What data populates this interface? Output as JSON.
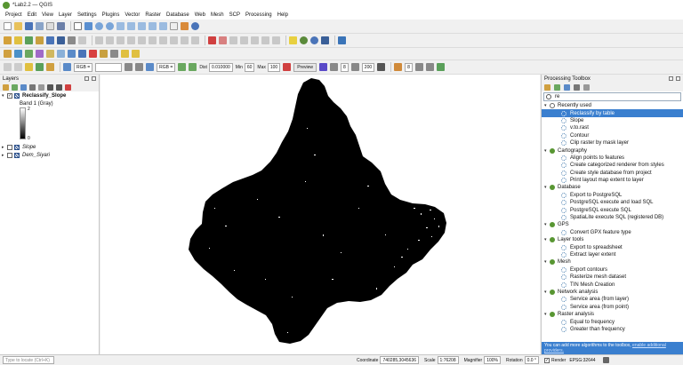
{
  "window": {
    "title": "*Lab2.2 — QGIS"
  },
  "menu": [
    "Project",
    "Edit",
    "View",
    "Layer",
    "Settings",
    "Plugins",
    "Vector",
    "Raster",
    "Database",
    "Web",
    "Mesh",
    "SCP",
    "Processing",
    "Help"
  ],
  "raster_toolbar": {
    "rgb1": "RGB",
    "rgb2": "RGB",
    "dist_label": "Dist",
    "dist_value": "0.010000",
    "min_label": "Min",
    "min_value": "60",
    "max_label": "Max",
    "max_value": "100",
    "preview_label": "Preview",
    "value_a": "8",
    "value_b": "200",
    "value_c": "8"
  },
  "layers": {
    "title": "Layers",
    "items": [
      {
        "name": "Reclassify_Slope",
        "checked": true,
        "expanded": true
      },
      {
        "name": "Slope",
        "checked": false,
        "expanded": false
      },
      {
        "name": "Dem_Siyari",
        "checked": false,
        "expanded": false
      }
    ],
    "band_label": "Band 1 (Gray)",
    "legend_max": "2",
    "legend_min": "0"
  },
  "toolbox": {
    "title": "Processing Toolbox",
    "search_value": "re",
    "groups": [
      {
        "name": "Recently used",
        "items": [
          "Reclassify by table",
          "Slope",
          "v.to.rast",
          "Contour",
          "Clip raster by mask layer"
        ]
      },
      {
        "name": "Cartography",
        "items": [
          "Align points to features",
          "Create categorized renderer from styles",
          "Create style database from project",
          "Print layout map extent to layer"
        ]
      },
      {
        "name": "Database",
        "items": [
          "Export to PostgreSQL",
          "PostgreSQL execute and load SQL",
          "PostgreSQL execute SQL",
          "SpatiaLite execute SQL (registered DB)"
        ]
      },
      {
        "name": "GPS",
        "items": [
          "Convert GPX feature type"
        ]
      },
      {
        "name": "Layer tools",
        "items": [
          "Export to spreadsheet",
          "Extract layer extent"
        ]
      },
      {
        "name": "Mesh",
        "items": [
          "Export contours",
          "Rasterize mesh dataset",
          "TIN Mesh Creation"
        ]
      },
      {
        "name": "Network analysis",
        "items": [
          "Service area (from layer)",
          "Service area (from point)"
        ]
      },
      {
        "name": "Raster analysis",
        "items": [
          "Equal to frequency",
          "Greater than frequency"
        ]
      }
    ],
    "selected_item": "Reclassify by table",
    "info_text": "You can add more algorithms to the toolbox,",
    "info_link": "enable additional providers."
  },
  "status": {
    "locate_placeholder": "Type to locate (Ctrl+K)",
    "coordinate_label": "Coordinate",
    "coordinate_value": "740285,3045636",
    "scale_label": "Scale",
    "scale_value": "1:76208",
    "magnifier_label": "Magnifier",
    "magnifier_value": "100%",
    "rotation_label": "Rotation",
    "rotation_value": "0.0 °",
    "render_label": "Render",
    "crs_value": "EPSG:32644"
  },
  "colors": {
    "accent": "#3a7fcf",
    "qgis_green": "#589632",
    "map_fill": "#000000"
  }
}
